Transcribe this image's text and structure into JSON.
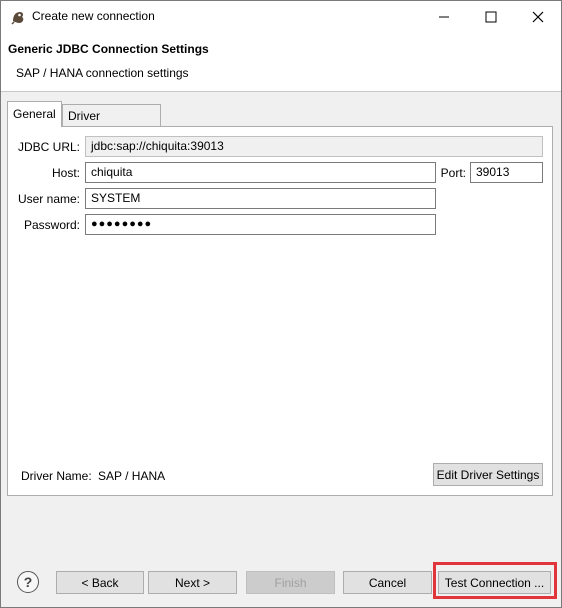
{
  "window": {
    "title": "Create new connection"
  },
  "header": {
    "title": "Generic JDBC Connection Settings",
    "subtitle": "SAP / HANA connection settings"
  },
  "tabs": [
    {
      "label": "General",
      "active": true
    },
    {
      "label": "Driver properties",
      "active": false
    }
  ],
  "form": {
    "jdbc_url_label": "JDBC URL:",
    "jdbc_url_value": "jdbc:sap://chiquita:39013",
    "host_label": "Host:",
    "host_value": "chiquita",
    "port_label": "Port:",
    "port_value": "39013",
    "user_label": "User name:",
    "user_value": "SYSTEM",
    "password_label": "Password:",
    "password_value": "●●●●●●●●",
    "driver_name_label": "Driver Name:",
    "driver_name_value": "SAP / HANA",
    "edit_driver_label": "Edit Driver Settings"
  },
  "footer": {
    "help_label": "?",
    "back_label": "< Back",
    "next_label": "Next >",
    "finish_label": "Finish",
    "cancel_label": "Cancel",
    "test_label": "Test Connection ..."
  },
  "colors": {
    "highlight": "#e0363b"
  }
}
